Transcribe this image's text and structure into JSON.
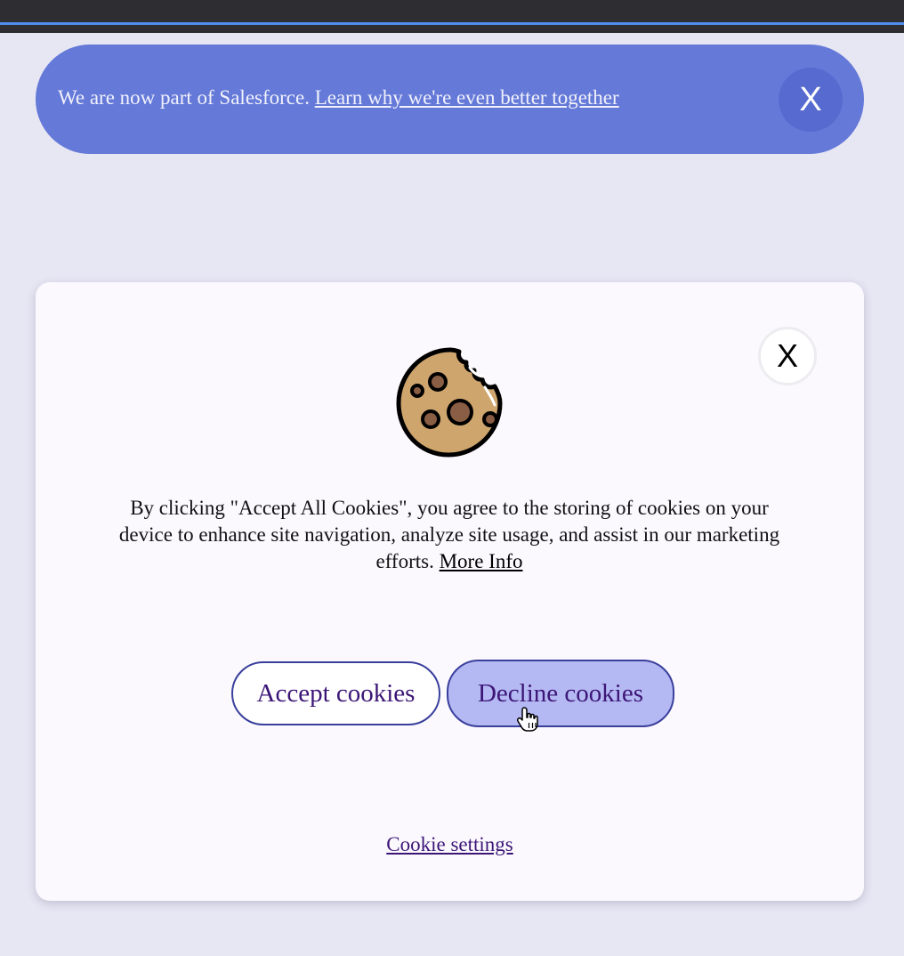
{
  "banner": {
    "text": "We are now part of Salesforce.",
    "link_label": "Learn why we're even better together",
    "close_label": "X",
    "background_color": "#6479d8"
  },
  "modal": {
    "close_label": "X",
    "icon": "cookie-icon",
    "message": "By clicking \"Accept All Cookies\", you agree to the storing of cookies on your device to enhance site navigation, analyze site usage, and assist in our marketing efforts.",
    "more_info_label": "More Info",
    "accept_label": "Accept cookies",
    "decline_label": "Decline cookies",
    "settings_label": "Cookie settings",
    "decline_background_color": "#b5b9f3"
  },
  "pointer": "hand-pointer-cursor"
}
